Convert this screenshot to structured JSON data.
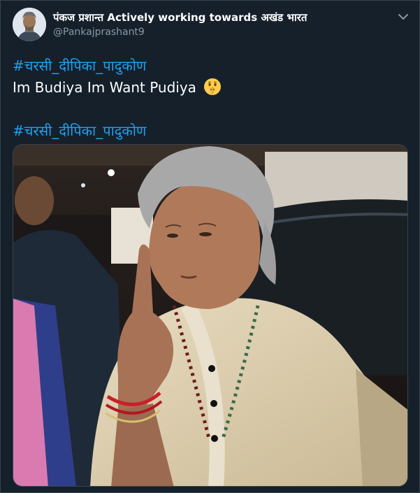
{
  "tweet": {
    "display_name": "पंकज प्रशान्त Actively working towards अखंड भारत",
    "handle": "@Pankajprashant9",
    "hashtag": "#चरसी_दीपिका_पादुकोण",
    "body_text": "Im Budiya Im Want Pudiya",
    "emoji": "shushing-face-emoji"
  },
  "icons": {
    "menu": "chevron-down-icon"
  },
  "colors": {
    "background": "#15202b",
    "accent": "#1da1f2",
    "secondary_text": "#8899a6",
    "border": "#38444d"
  }
}
